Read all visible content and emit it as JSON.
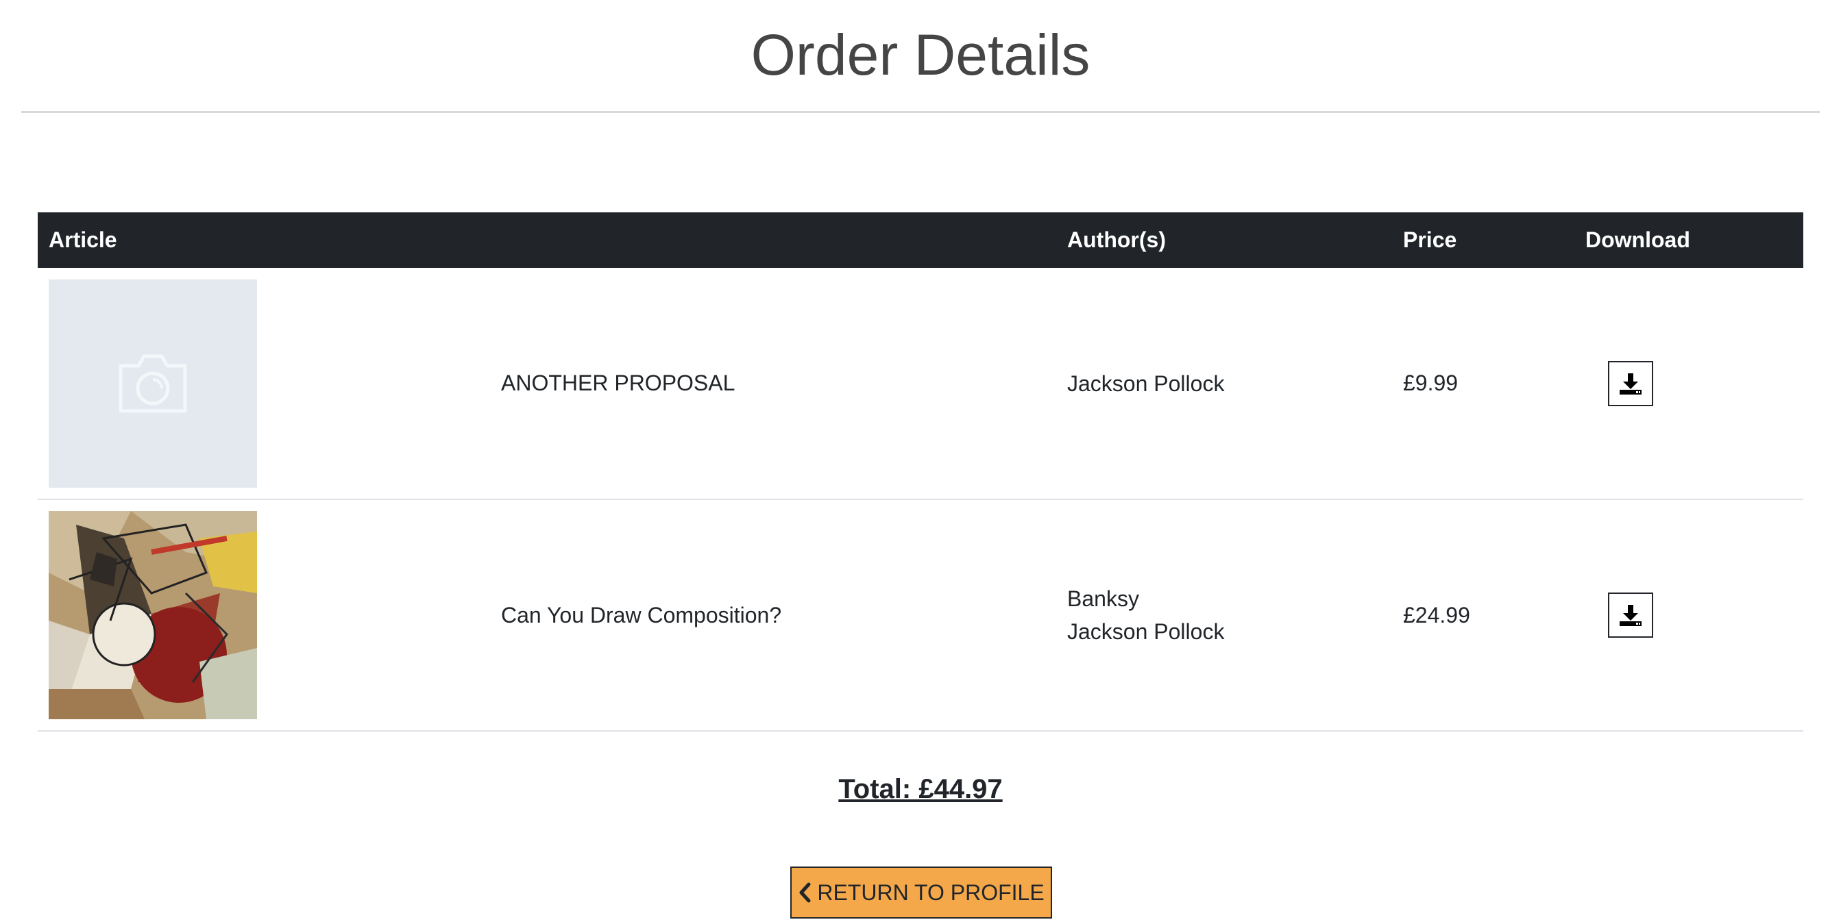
{
  "page": {
    "title": "Order Details"
  },
  "table": {
    "headers": {
      "article": "Article",
      "title": "",
      "authors": "Author(s)",
      "price": "Price",
      "download": "Download"
    },
    "rows": [
      {
        "thumbnail": "camera-placeholder-icon",
        "title": "ANOTHER PROPOSAL",
        "authors": [
          "Jackson Pollock"
        ],
        "price": "£9.99",
        "download_icon": "download-icon"
      },
      {
        "thumbnail": "artwork-image",
        "title": "Can You Draw Composition?",
        "authors": [
          "Banksy",
          "Jackson Pollock"
        ],
        "price": "£24.99",
        "download_icon": "download-icon"
      }
    ]
  },
  "summary": {
    "total": "Total: £44.97"
  },
  "actions": {
    "return_label": "RETURN TO PROFILE"
  },
  "colors": {
    "header_bg": "#212529",
    "accent_button": "#f4a84a",
    "placeholder_bg": "#e3e9ef"
  }
}
